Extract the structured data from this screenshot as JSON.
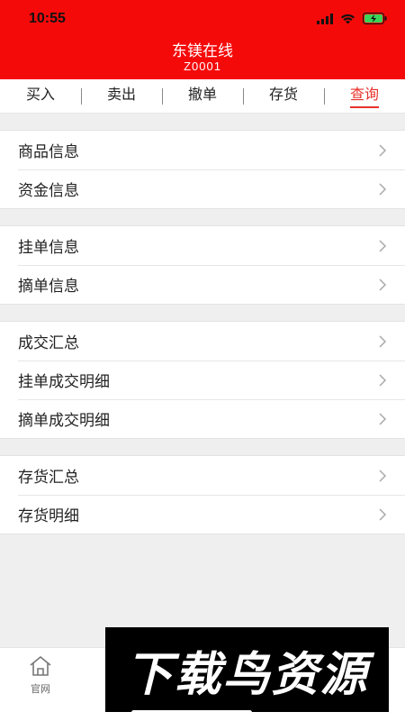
{
  "status_bar": {
    "time": "10:55"
  },
  "header": {
    "title": "东镁在线",
    "subtitle": "Z0001"
  },
  "tabs": [
    {
      "label": "买入",
      "active": false
    },
    {
      "label": "卖出",
      "active": false
    },
    {
      "label": "撤单",
      "active": false
    },
    {
      "label": "存货",
      "active": false
    },
    {
      "label": "查询",
      "active": true
    }
  ],
  "groups": [
    {
      "items": [
        {
          "label": "商品信息"
        },
        {
          "label": "资金信息"
        }
      ]
    },
    {
      "items": [
        {
          "label": "挂单信息"
        },
        {
          "label": "摘单信息"
        }
      ]
    },
    {
      "items": [
        {
          "label": "成交汇总"
        },
        {
          "label": "挂单成交明细"
        },
        {
          "label": "摘单成交明细"
        }
      ]
    },
    {
      "items": [
        {
          "label": "存货汇总"
        },
        {
          "label": "存货明细"
        }
      ]
    }
  ],
  "bottom_nav": {
    "items": [
      {
        "label": "官网",
        "icon": "home-icon"
      }
    ]
  },
  "watermark": {
    "text": "下载鸟资源"
  },
  "colors": {
    "header_red": "#f50a0a",
    "active_tab": "#e8312a"
  }
}
